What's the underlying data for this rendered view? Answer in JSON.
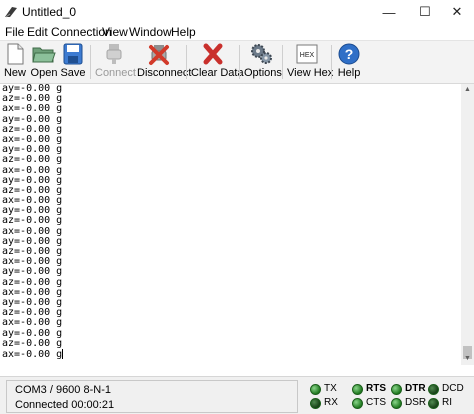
{
  "window": {
    "title": "Untitled_0",
    "minimize": "—",
    "maximize": "☐",
    "close": "✕"
  },
  "menu": [
    "File",
    "Edit",
    "Connection",
    "View",
    "Window",
    "Help"
  ],
  "toolbar": {
    "new": "New",
    "open": "Open",
    "save": "Save",
    "connect": "Connect",
    "disconnect": "Disconnect",
    "clear": "Clear Data",
    "options": "Options",
    "viewhex": "View Hex",
    "help": "Help",
    "hex_icon_text": "HEX",
    "help_icon_text": "?"
  },
  "terminal": {
    "lines": [
      "ay=-0.00 g",
      "az=-0.00 g",
      "ax=-0.00 g",
      "ay=-0.00 g",
      "az=-0.00 g",
      "ax=-0.00 g",
      "ay=-0.00 g",
      "az=-0.00 g",
      "ax=-0.00 g",
      "ay=-0.00 g",
      "az=-0.00 g",
      "ax=-0.00 g",
      "ay=-0.00 g",
      "az=-0.00 g",
      "ax=-0.00 g",
      "ay=-0.00 g",
      "az=-0.00 g",
      "ax=-0.00 g",
      "ay=-0.00 g",
      "az=-0.00 g",
      "ax=-0.00 g",
      "ay=-0.00 g",
      "az=-0.00 g",
      "ax=-0.00 g",
      "ay=-0.00 g",
      "az=-0.00 g",
      "ax=-0.00 g"
    ]
  },
  "status": {
    "port": "COM3 / 9600 8-N-1",
    "connected": "Connected 00:00:21",
    "signals": {
      "tx": "TX",
      "rx": "RX",
      "rts": "RTS",
      "cts": "CTS",
      "dtr": "DTR",
      "dsr": "DSR",
      "dcd": "DCD",
      "ri": "RI"
    }
  },
  "colors": {
    "led_on": "#2e9b2e",
    "led_dim": "#1f5a1f",
    "toolbar_bg": "#f3f3f3"
  }
}
